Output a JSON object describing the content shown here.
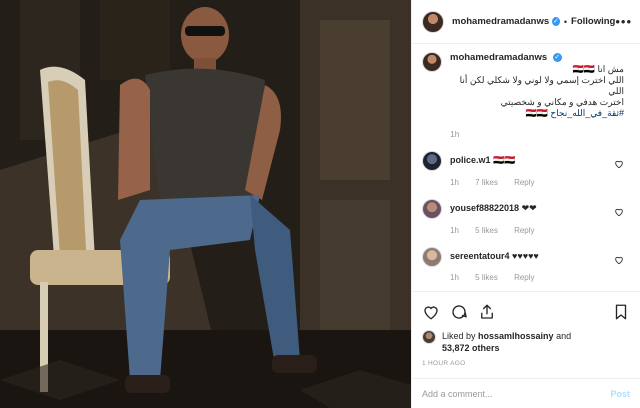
{
  "post": {
    "photo_alt": "",
    "username": "mohamedramadanws",
    "follow_label": "Following",
    "more_label": "•••"
  },
  "caption": {
    "username": "mohamedramadanws",
    "lines": [
      "مش انا 🇪🇬🇪🇬",
      "اللي اخترت إسمي ولا لوني ولا شكلي لكن أنا اللي",
      "اخترت هدفي و مكاني و شخصيتي",
      "#ثقة_في_الله_نجاح 🇪🇬🇪🇬"
    ],
    "time_ago": "1h"
  },
  "comments": [
    {
      "username": "police.w1",
      "text": "🇪🇬🇪🇬",
      "time": "1h",
      "likes": "7 likes",
      "reply": "Reply"
    },
    {
      "username": "yousef88822018",
      "text": "❤❤",
      "time": "1h",
      "likes": "5 likes",
      "reply": "Reply"
    },
    {
      "username": "sereentatour4",
      "text": "♥♥♥♥♥",
      "time": "1h",
      "likes": "5 likes",
      "reply": "Reply"
    }
  ],
  "likes": {
    "prefix": "Liked by ",
    "user": "hossamlhossainy",
    "and": " and",
    "others": "53,872 others"
  },
  "post_time": "1 HOUR AGO",
  "add_comment": {
    "placeholder": "Add a comment...",
    "post_label": "Post"
  },
  "colors": {
    "link": "#003569",
    "verified": "#3897f0",
    "post_disabled": "#b2dffc",
    "muted": "#999999"
  }
}
